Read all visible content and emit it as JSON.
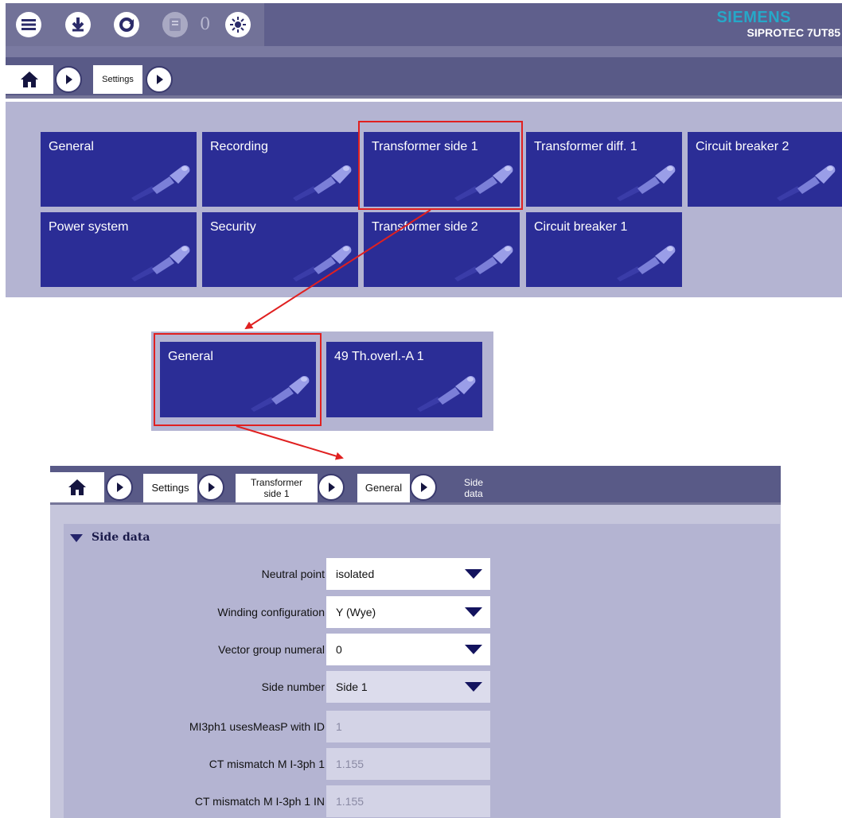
{
  "brand": {
    "name": "SIEMENS",
    "model": "SIPROTEC 7UT85"
  },
  "toolbar": {
    "buttons": [
      {
        "icon": "menu-icon"
      },
      {
        "icon": "download-icon"
      },
      {
        "icon": "refresh-icon"
      },
      {
        "icon": "device-icon",
        "disabled": true
      },
      {
        "icon": "led-icon"
      }
    ],
    "count": "0"
  },
  "breadcrumb_top": {
    "items": [
      "Settings"
    ]
  },
  "tiles_main": [
    "General",
    "Recording",
    "Transformer side 1",
    "Transformer diff. 1",
    "Circuit breaker 2",
    "Power system",
    "Security",
    "Transformer side 2",
    "Circuit breaker 1"
  ],
  "tiles_sub": [
    "General",
    "49 Th.overl.-A 1"
  ],
  "breadcrumb_bottom": {
    "items": [
      "Settings",
      "Transformer side 1",
      "General"
    ],
    "current": "Side data"
  },
  "form": {
    "section": "Side data",
    "rows": [
      {
        "label": "Neutral point",
        "value": "isolated",
        "kind": "select"
      },
      {
        "label": "Winding configuration",
        "value": "Y (Wye)",
        "kind": "select"
      },
      {
        "label": "Vector group numeral",
        "value": "0",
        "kind": "select"
      },
      {
        "label": "Side number",
        "value": "Side 1",
        "kind": "select-dim"
      },
      {
        "label": "MI3ph1 usesMeasP with ID",
        "value": "1",
        "kind": "readonly"
      },
      {
        "label": "CT mismatch M I-3ph 1",
        "value": "1.155",
        "kind": "readonly"
      },
      {
        "label": "CT mismatch M I-3ph 1 IN",
        "value": "1.155",
        "kind": "readonly"
      }
    ]
  },
  "colors": {
    "tile": "#2b2d96",
    "highlight": "#e02020",
    "panel": "#b4b4d2",
    "toolbar": "#5f5f8c"
  }
}
